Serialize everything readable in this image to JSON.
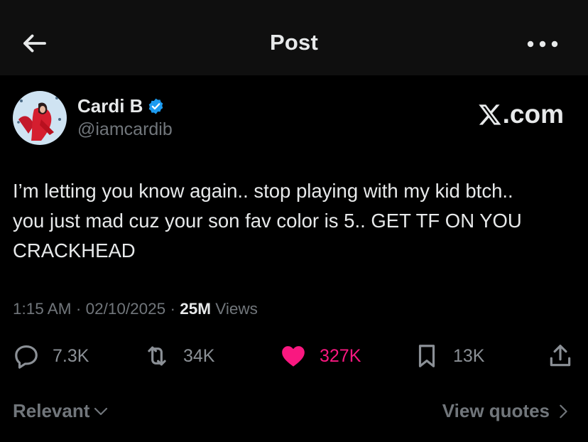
{
  "header": {
    "title": "Post",
    "back_icon": "arrow-left-icon",
    "more_icon": "more-horizontal-icon"
  },
  "author": {
    "display_name": "Cardi B",
    "handle": "@iamcardib",
    "verified": true,
    "verified_color": "#1d9bf0"
  },
  "source_label": ".com",
  "tweet": {
    "lines": [
      "I’m letting you know again.. stop playing with my kid btch..",
      "you just mad cuz your son fav color is 5.. GET TF ON YOU",
      "CRACKHEAD"
    ]
  },
  "meta": {
    "time": "1:15 AM",
    "separator": " · ",
    "date": "02/10/2025",
    "views_count": "25M",
    "views_label": " Views"
  },
  "actions": {
    "replies": "7.3K",
    "reposts": "34K",
    "likes": "327K",
    "bookmarks": "13K",
    "like_color": "#f91880"
  },
  "footer": {
    "sort_label": "Relevant",
    "quotes_label": "View quotes"
  }
}
